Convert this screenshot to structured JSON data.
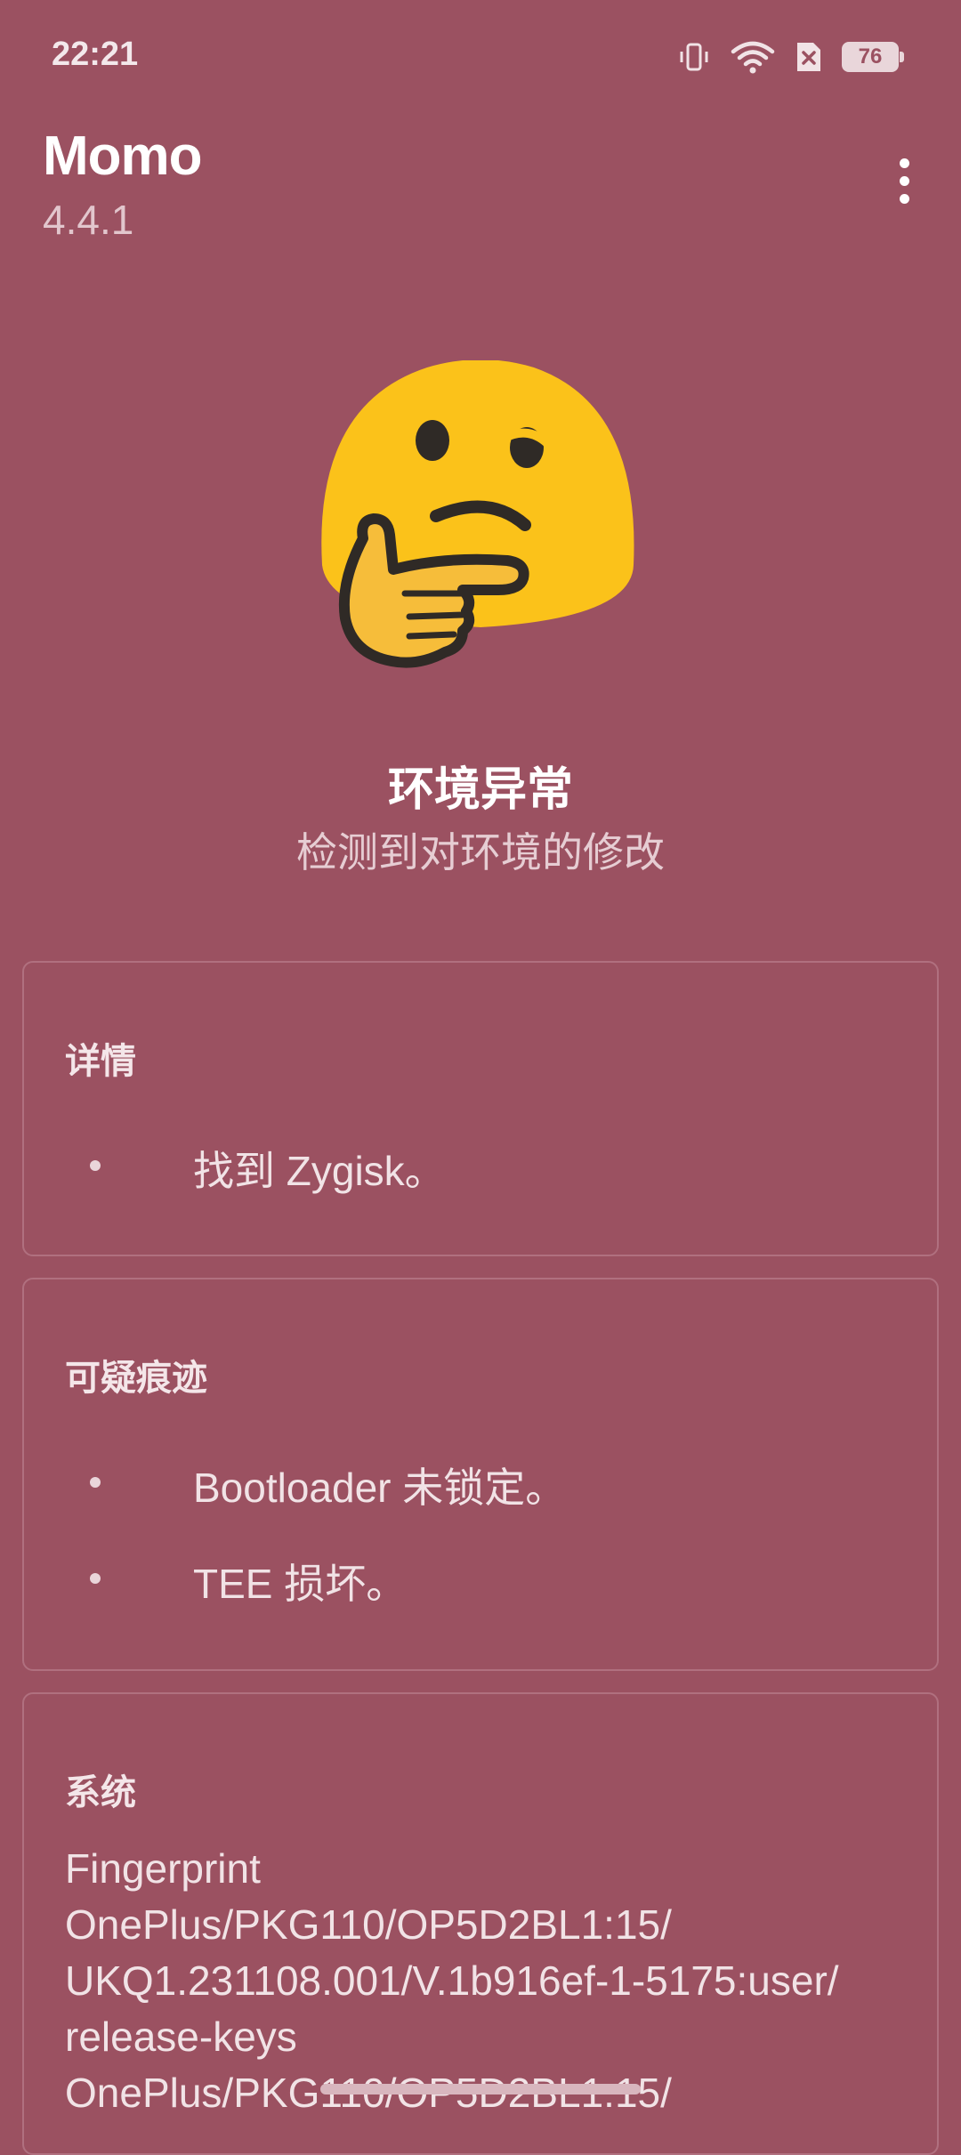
{
  "status_bar": {
    "time": "22:21",
    "battery": "76"
  },
  "header": {
    "title": "Momo",
    "version": "4.4.1"
  },
  "result": {
    "title": "环境异常",
    "subtitle": "检测到对环境的修改"
  },
  "cards": {
    "details": {
      "title": "详情",
      "items": [
        "找到 Zygisk。"
      ]
    },
    "suspicious": {
      "title": "可疑痕迹",
      "items": [
        "Bootloader 未锁定。",
        "TEE 损坏。"
      ]
    },
    "system": {
      "title": "系统",
      "lines": [
        "Fingerprint",
        "OnePlus/PKG110/OP5D2BL1:15/",
        "UKQ1.231108.001/V.1b916ef-1-5175:user/",
        "release-keys",
        "OnePlus/PKG110/OP5D2BL1:15/"
      ]
    }
  },
  "colors": {
    "background": "#9b5161",
    "card_border": "#b0707f",
    "emoji_face": "#fbc21a"
  }
}
